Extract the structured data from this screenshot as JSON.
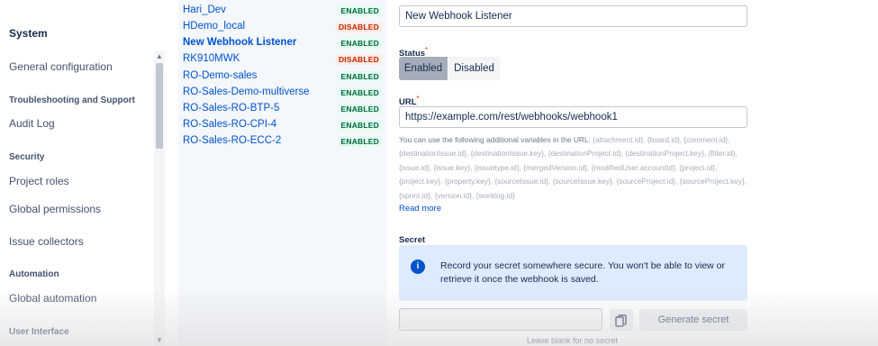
{
  "sidebar": {
    "system": "System",
    "general_configuration": "General configuration",
    "troubleshooting_heading": "Troubleshooting and Support",
    "audit_log": "Audit Log",
    "security_heading": "Security",
    "project_roles": "Project roles",
    "global_permissions": "Global permissions",
    "issue_collectors": "Issue collectors",
    "automation_heading": "Automation",
    "global_automation": "Global automation",
    "user_interface_heading": "User Interface"
  },
  "webhooks": [
    {
      "name": "Hari_Dev",
      "status": "ENABLED"
    },
    {
      "name": "HDemo_local",
      "status": "DISABLED"
    },
    {
      "name": "New Webhook Listener",
      "status": "ENABLED"
    },
    {
      "name": "RK910MWK",
      "status": "DISABLED"
    },
    {
      "name": "RO-Demo-sales",
      "status": "ENABLED"
    },
    {
      "name": "RO-Sales-Demo-multiverse",
      "status": "ENABLED"
    },
    {
      "name": "RO-Sales-RO-BTP-5",
      "status": "ENABLED"
    },
    {
      "name": "RO-Sales-RO-CPI-4",
      "status": "ENABLED"
    },
    {
      "name": "RO-Sales-RO-ECC-2",
      "status": "ENABLED"
    }
  ],
  "form": {
    "name_value": "New Webhook Listener",
    "status_label": "Status",
    "required_mark": "*",
    "status_enabled": "Enabled",
    "status_disabled": "Disabled",
    "url_label": "URL",
    "url_value": "https://example.com/rest/webhooks/webhook1",
    "help_lead": "You can use the following additional variables in the URL:",
    "help_vars": "{attachment.id}, {board.id}, {comment.id}, {destinationIssue.id}, {destinationIssue.key}, {destinationProject.id}, {destinationProject.key}, {filter.id}, {issue.id}, {issue.key}, {issuetype.id}, {mergedVersion.id}, {modifiedUser.accountId}, {project.id}, {project.key}, {property.key}, {sourceIssue.id}, {sourceIssue.key}, {sourceProject.id}, {sourceProject.key}, {sprint.id}, {version.id}, {worklog.id}",
    "read_more": "Read more",
    "secret_label": "Secret",
    "secret_info": "Record your secret somewhere secure. You won't be able to view or retrieve it once the webhook is saved.",
    "generate_secret": "Generate secret",
    "secret_hint": "Leave blank for no secret"
  },
  "colors": {
    "link": "#0052cc",
    "enabled_text": "#006644",
    "disabled_text": "#bf2600",
    "info_bg": "#deebff"
  },
  "icons": {
    "info": "info-icon",
    "copy": "copy-icon",
    "scroll_up": "chevron-up-icon",
    "scroll_down": "chevron-down-icon"
  }
}
